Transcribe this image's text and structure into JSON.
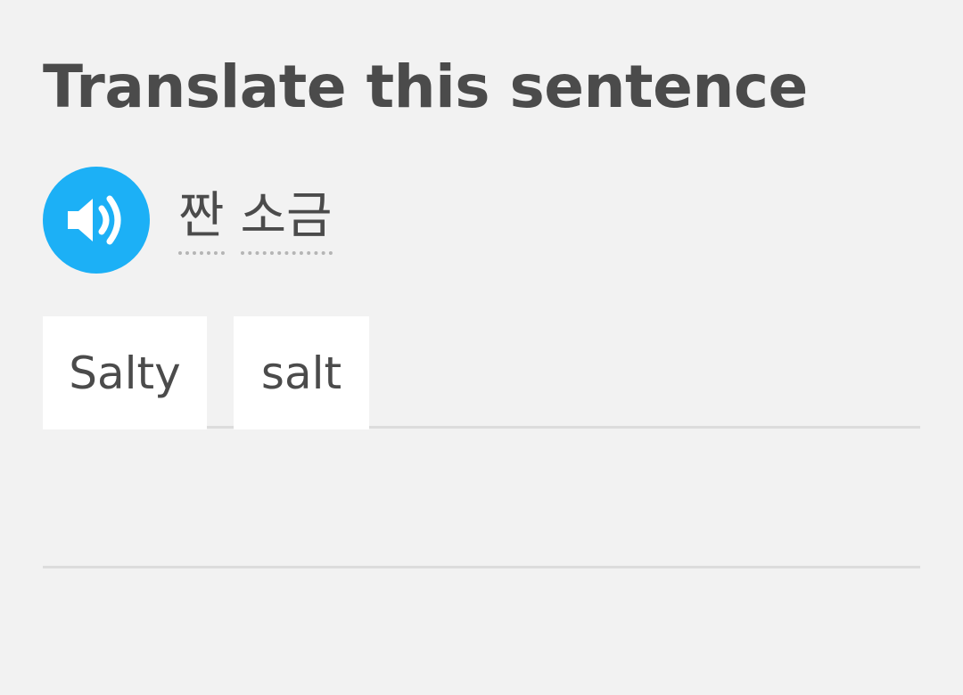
{
  "header": {
    "title": "Translate this sentence"
  },
  "prompt": {
    "audio_icon": "speaker-icon",
    "words": [
      "짠",
      "소금"
    ]
  },
  "answer": {
    "selected_tiles": [
      "Salty",
      "salt"
    ]
  },
  "colors": {
    "background": "#f2f2f2",
    "accent": "#1cb0f6",
    "text": "#4b4b4b",
    "tile": "#ffffff",
    "divider": "#dcdcdc"
  }
}
